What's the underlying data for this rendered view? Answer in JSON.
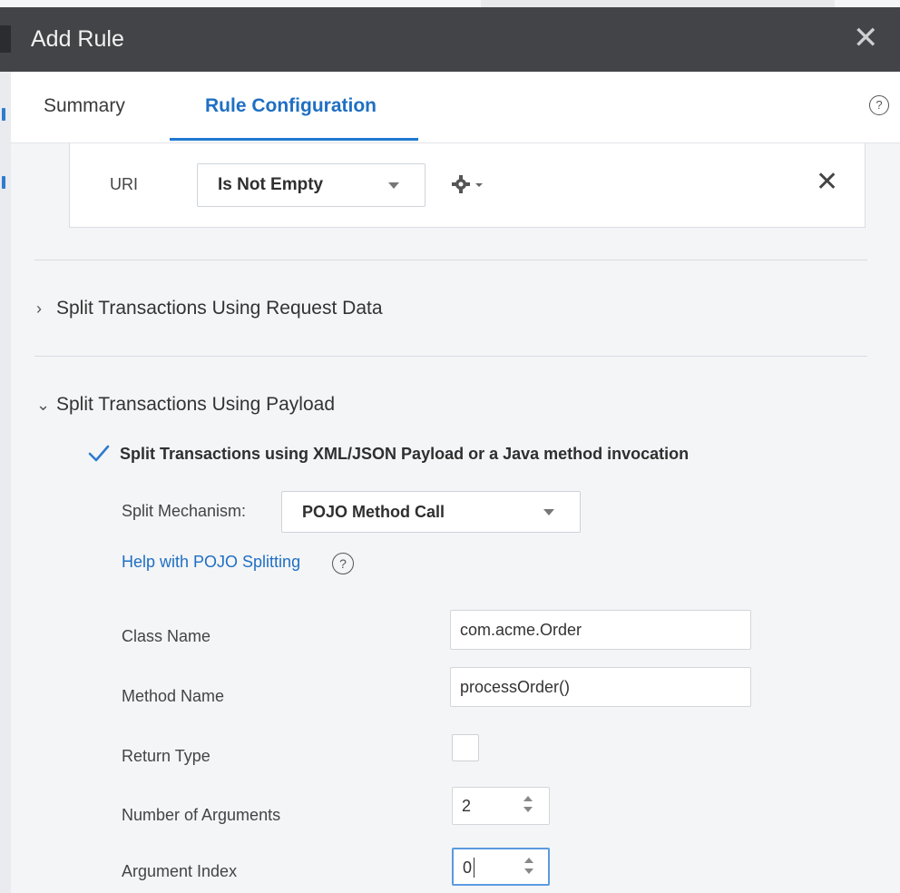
{
  "dialog": {
    "title": "Add Rule"
  },
  "tabs": [
    {
      "label": "Summary",
      "active": false
    },
    {
      "label": "Rule Configuration",
      "active": true
    }
  ],
  "uri_condition": {
    "label": "URI",
    "operator": "Is Not Empty"
  },
  "sections": {
    "request_data": {
      "label": "Split Transactions Using Request Data",
      "expanded": false
    },
    "payload": {
      "label": "Split Transactions Using Payload",
      "expanded": true
    }
  },
  "payload": {
    "checkbox_label": "Split Transactions using XML/JSON Payload or a Java method invocation",
    "checkbox_checked": true,
    "split_mechanism_label": "Split Mechanism:",
    "split_mechanism_value": "POJO Method Call",
    "help_link": "Help with POJO Splitting",
    "fields": {
      "class_name_label": "Class Name",
      "class_name_value": "com.acme.Order",
      "method_name_label": "Method Name",
      "method_name_value": "processOrder()",
      "return_type_label": "Return Type",
      "return_type_checked": false,
      "num_args_label": "Number of Arguments",
      "num_args_value": "2",
      "arg_index_label": "Argument Index",
      "arg_index_value": "0"
    }
  },
  "colors": {
    "titlebar": "#434447",
    "accent": "#1f6fc3",
    "focus": "#5b9ae0"
  },
  "icons": {
    "close": "close-icon",
    "help": "help-icon",
    "gear": "gear-icon",
    "checkmark": "checkmark-icon",
    "chevron_right": "chevron-right-icon",
    "chevron_down": "chevron-down-icon"
  }
}
